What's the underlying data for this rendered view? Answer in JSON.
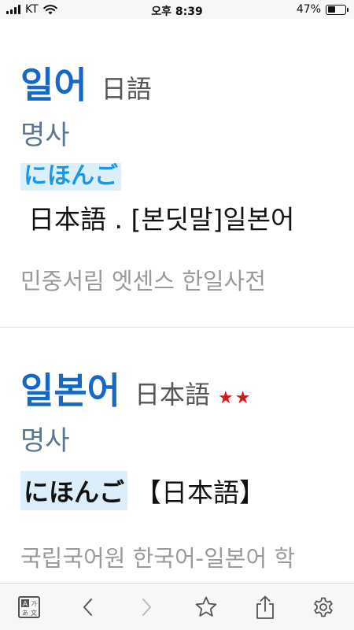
{
  "status_bar": {
    "carrier": "KT",
    "time": "오후 8:39",
    "battery_percent": "47%",
    "battery_level": 0.47
  },
  "entries": [
    {
      "headword": "일어",
      "hanja": "日語",
      "stars": "",
      "part_of_speech": "명사",
      "kana": "にほんご",
      "definition": "日本語 . [본딧말]일본어",
      "source": "민중서림 엣센스 한일사전"
    },
    {
      "headword": "일본어",
      "hanja": "日本語",
      "stars": "★★",
      "part_of_speech": "명사",
      "kana": "にほんご",
      "definition": "【日本語】",
      "source": "국립국어원 한국어-일본어 학"
    }
  ],
  "toolbar": {
    "icons": [
      "translate-icon",
      "chevron-left-icon",
      "chevron-right-icon",
      "star-icon",
      "share-icon",
      "gear-icon"
    ],
    "forward_disabled": true
  },
  "colors": {
    "headword": "#1368c8",
    "part_of_speech": "#5c7590",
    "kana_highlight_bg": "#dceefa",
    "kana_text": "#1a9ae4",
    "star": "#d81818",
    "source_text": "#9a9a9a"
  }
}
